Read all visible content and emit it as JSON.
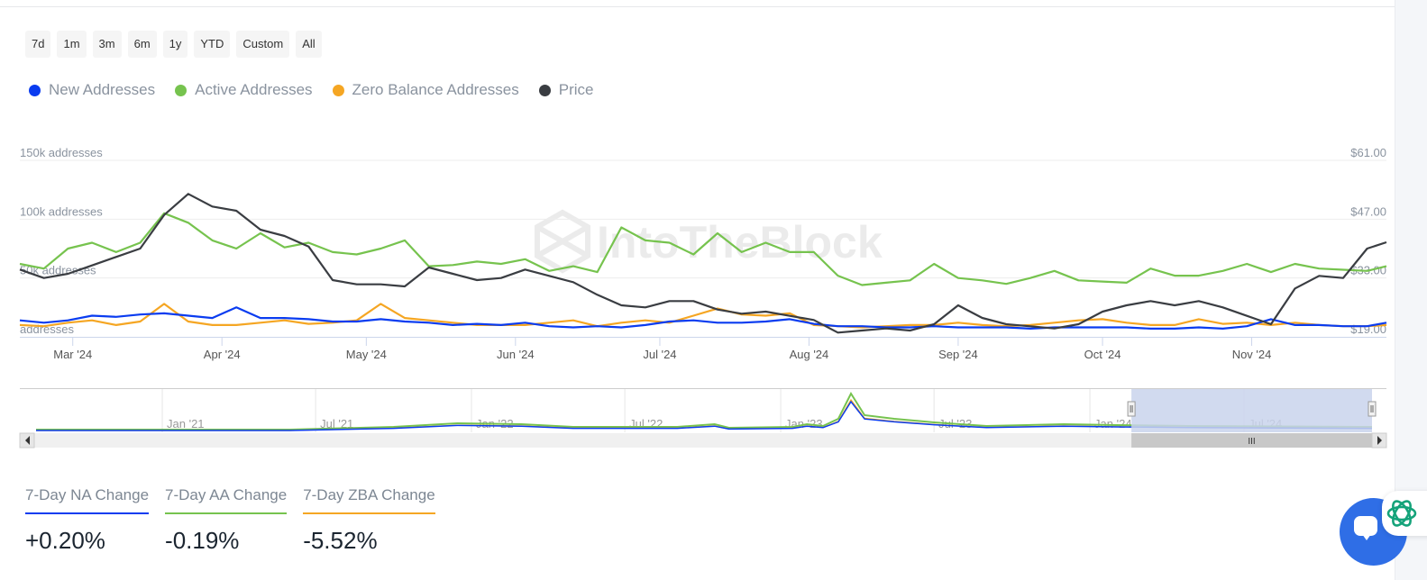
{
  "range_buttons": [
    "7d",
    "1m",
    "3m",
    "6m",
    "1y",
    "YTD",
    "Custom",
    "All"
  ],
  "legend": [
    {
      "label": "New Addresses",
      "color": "#0a3cf0"
    },
    {
      "label": "Active Addresses",
      "color": "#76c34e"
    },
    {
      "label": "Zero Balance Addresses",
      "color": "#f5a623"
    },
    {
      "label": "Price",
      "color": "#3a3d42"
    }
  ],
  "watermark": "IntoTheBlock",
  "chart_data": {
    "type": "line",
    "title": "",
    "xlabel": "",
    "ylabel": "addresses",
    "x_tick_labels": [
      "Mar '24",
      "Apr '24",
      "May '24",
      "Jun '24",
      "Jul '24",
      "Aug '24",
      "Sep '24",
      "Oct '24",
      "Nov '24"
    ],
    "x_tick_dates": [
      "2024-03-01",
      "2024-04-01",
      "2024-05-01",
      "2024-06-01",
      "2024-07-01",
      "2024-08-01",
      "2024-09-01",
      "2024-10-01",
      "2024-11-01"
    ],
    "x_range": [
      "2024-02-19",
      "2024-11-29"
    ],
    "left_axis": {
      "ticks": [
        "addresses",
        "50k addresses",
        "100k addresses",
        "150k addresses"
      ],
      "tick_values": [
        0,
        50000,
        100000,
        150000
      ],
      "ylim": [
        0,
        150000
      ]
    },
    "right_axis": {
      "ticks": [
        "$19.00",
        "$33.00",
        "$47.00",
        "$61.00"
      ],
      "tick_values": [
        19,
        33,
        47,
        61
      ],
      "ylim": [
        19,
        61
      ]
    },
    "grid": true,
    "legend_position": "top-left",
    "x": [
      "2024-02-19",
      "2024-02-24",
      "2024-02-29",
      "2024-03-05",
      "2024-03-10",
      "2024-03-15",
      "2024-03-20",
      "2024-03-25",
      "2024-03-30",
      "2024-04-04",
      "2024-04-09",
      "2024-04-14",
      "2024-04-19",
      "2024-04-24",
      "2024-04-29",
      "2024-05-04",
      "2024-05-09",
      "2024-05-14",
      "2024-05-19",
      "2024-05-24",
      "2024-05-29",
      "2024-06-03",
      "2024-06-08",
      "2024-06-13",
      "2024-06-18",
      "2024-06-23",
      "2024-06-28",
      "2024-07-03",
      "2024-07-08",
      "2024-07-13",
      "2024-07-18",
      "2024-07-23",
      "2024-07-28",
      "2024-08-02",
      "2024-08-07",
      "2024-08-12",
      "2024-08-17",
      "2024-08-22",
      "2024-08-27",
      "2024-09-01",
      "2024-09-06",
      "2024-09-11",
      "2024-09-16",
      "2024-09-21",
      "2024-09-26",
      "2024-10-01",
      "2024-10-06",
      "2024-10-11",
      "2024-10-16",
      "2024-10-21",
      "2024-10-26",
      "2024-10-31",
      "2024-11-05",
      "2024-11-10",
      "2024-11-15",
      "2024-11-20",
      "2024-11-25",
      "2024-11-29"
    ],
    "series": [
      {
        "name": "New Addresses",
        "axis": "left",
        "color": "#0a3cf0",
        "values": [
          14000,
          12000,
          14000,
          18000,
          17000,
          19000,
          20000,
          18000,
          16000,
          25000,
          16000,
          16000,
          15000,
          13000,
          13000,
          15000,
          13000,
          12000,
          10000,
          11000,
          10000,
          12000,
          9000,
          8000,
          9000,
          8000,
          10000,
          13000,
          14000,
          12000,
          12000,
          13000,
          15000,
          11000,
          9000,
          9000,
          8000,
          8000,
          9000,
          8000,
          8000,
          8000,
          7000,
          8000,
          8000,
          8000,
          8000,
          7000,
          7000,
          8000,
          7000,
          9000,
          15000,
          10000,
          10000,
          9000,
          9000,
          12000
        ]
      },
      {
        "name": "Active Addresses",
        "axis": "left",
        "color": "#76c34e",
        "values": [
          62000,
          58000,
          75000,
          80000,
          72000,
          80000,
          105000,
          97000,
          82000,
          75000,
          88000,
          76000,
          80000,
          72000,
          70000,
          75000,
          82000,
          60000,
          61000,
          64000,
          62000,
          66000,
          56000,
          60000,
          55000,
          93000,
          82000,
          80000,
          70000,
          88000,
          72000,
          80000,
          72000,
          72000,
          52000,
          44000,
          46000,
          48000,
          62000,
          50000,
          48000,
          45000,
          50000,
          56000,
          48000,
          47000,
          46000,
          58000,
          52000,
          52000,
          56000,
          62000,
          55000,
          62000,
          58000,
          57000,
          56000,
          60000
        ]
      },
      {
        "name": "Zero Balance Addresses",
        "axis": "left",
        "color": "#f5a623",
        "values": [
          10000,
          9000,
          12000,
          14000,
          10000,
          13000,
          28000,
          13000,
          10000,
          10000,
          12000,
          14000,
          11000,
          12000,
          14000,
          28000,
          16000,
          14000,
          12000,
          10000,
          10000,
          10000,
          12000,
          14000,
          9000,
          12000,
          14000,
          12000,
          18000,
          24000,
          19000,
          18000,
          20000,
          10000,
          9000,
          8000,
          9000,
          10000,
          10000,
          12000,
          10000,
          9000,
          10000,
          12000,
          14000,
          15000,
          12000,
          10000,
          10000,
          15000,
          11000,
          12000,
          10000,
          12000,
          10000,
          9000,
          9000,
          10000
        ]
      },
      {
        "name": "Price",
        "axis": "right",
        "color": "#3a3d42",
        "values": [
          35.0,
          33.0,
          34.0,
          36.0,
          38.0,
          40.0,
          48.0,
          53.0,
          50.0,
          49.0,
          44.5,
          43.0,
          40.5,
          32.5,
          31.5,
          31.5,
          31.0,
          35.5,
          34.0,
          32.5,
          33.0,
          35.0,
          33.5,
          32.0,
          29.0,
          26.5,
          26.0,
          27.5,
          27.5,
          25.5,
          24.5,
          25.0,
          24.0,
          23.0,
          20.0,
          20.5,
          21.0,
          20.5,
          22.0,
          26.5,
          23.5,
          22.0,
          21.5,
          21.0,
          22.0,
          25.0,
          26.5,
          27.5,
          26.5,
          27.5,
          26.0,
          24.0,
          22.0,
          30.5,
          33.5,
          33.0,
          40.0,
          41.5
        ]
      }
    ]
  },
  "navigator": {
    "tick_labels": [
      "Jan '21",
      "Jul '21",
      "Jan '22",
      "Jul '22",
      "Jan '23",
      "Jul '23",
      "Jan '24",
      "Jul '24"
    ],
    "selection_start": "2024-02-19",
    "selection_end": "2024-11-29"
  },
  "stats": [
    {
      "label": "7-Day NA Change",
      "value": "+0.20%",
      "color": "#0a3cf0"
    },
    {
      "label": "7-Day AA Change",
      "value": "-0.19%",
      "color": "#76c34e"
    },
    {
      "label": "7-Day ZBA Change",
      "value": "-5.52%",
      "color": "#f5a623"
    }
  ]
}
